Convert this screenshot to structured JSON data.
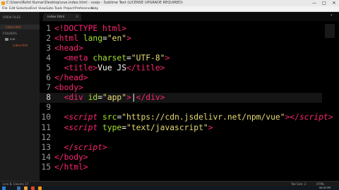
{
  "window": {
    "title": "C:\\Users\\Rohit Kumar\\Desktop\\vue.index.html - vuejs - Sublime Text (LICENSE UPGRADE REQUIRED)",
    "minimize": "—",
    "maximize": "□",
    "close": "✕"
  },
  "menu": [
    "File",
    "Edit",
    "Selection",
    "Find",
    "View",
    "Goto",
    "Tools",
    "Project",
    "Preferences",
    "Help"
  ],
  "sidebar": {
    "open_files_header": "OPEN FILES",
    "open_files": [
      "index.html"
    ],
    "folders_header": "FOLDERS",
    "folder_name": "vue",
    "folder_files": [
      "index.html"
    ]
  },
  "tab": {
    "label": "index.html",
    "close": "×",
    "dropdown": "▾"
  },
  "editor": {
    "lines": [
      {
        "n": "1",
        "parts": [
          {
            "t": "<!DOCTYPE html>",
            "c": "tk-tag"
          }
        ]
      },
      {
        "n": "2",
        "parts": [
          {
            "t": "<html",
            "c": "tk-tag"
          },
          {
            "t": " lang",
            "c": "tk-attr"
          },
          {
            "t": "=",
            "c": "tk-txt"
          },
          {
            "t": "\"en\"",
            "c": "tk-str"
          },
          {
            "t": ">",
            "c": "tk-tag"
          }
        ]
      },
      {
        "n": "3",
        "parts": [
          {
            "t": "<head>",
            "c": "tk-tag"
          }
        ]
      },
      {
        "n": "4",
        "parts": [
          {
            "t": "  <meta",
            "c": "tk-tag"
          },
          {
            "t": " charset",
            "c": "tk-attr"
          },
          {
            "t": "=",
            "c": "tk-txt"
          },
          {
            "t": "\"UTF-8\"",
            "c": "tk-str"
          },
          {
            "t": ">",
            "c": "tk-tag"
          }
        ]
      },
      {
        "n": "5",
        "parts": [
          {
            "t": "  <title>",
            "c": "tk-tag"
          },
          {
            "t": "Vue JS",
            "c": "tk-txt"
          },
          {
            "t": "</title>",
            "c": "tk-tag"
          }
        ]
      },
      {
        "n": "6",
        "parts": [
          {
            "t": "</head>",
            "c": "tk-tag"
          }
        ]
      },
      {
        "n": "7",
        "parts": [
          {
            "t": "<body>",
            "c": "tk-tag"
          }
        ]
      },
      {
        "n": "8",
        "parts": [
          {
            "t": "  <div",
            "c": "tk-tag"
          },
          {
            "t": " id",
            "c": "tk-attr"
          },
          {
            "t": "=",
            "c": "tk-txt"
          },
          {
            "t": "\"app\"",
            "c": "tk-str"
          },
          {
            "t": ">",
            "c": "tk-tag"
          },
          {
            "t": "|",
            "c": "tk-txt"
          },
          {
            "t": "</div>",
            "c": "tk-tag"
          }
        ],
        "highlight": true
      },
      {
        "n": "9",
        "parts": []
      },
      {
        "n": "10",
        "parts": [
          {
            "t": "  <",
            "c": "tk-tag"
          },
          {
            "t": "script",
            "c": "tk-scr"
          },
          {
            "t": " src",
            "c": "tk-attr"
          },
          {
            "t": "=",
            "c": "tk-txt"
          },
          {
            "t": "\"https://cdn.jsdelivr.net/npm/vue\"",
            "c": "tk-str"
          },
          {
            "t": "></",
            "c": "tk-tag"
          },
          {
            "t": "script",
            "c": "tk-scr"
          },
          {
            "t": ">",
            "c": "tk-tag"
          }
        ]
      },
      {
        "n": "11",
        "parts": [
          {
            "t": "  <",
            "c": "tk-tag"
          },
          {
            "t": "script",
            "c": "tk-scr"
          },
          {
            "t": " type",
            "c": "tk-attr"
          },
          {
            "t": "=",
            "c": "tk-txt"
          },
          {
            "t": "\"text/javascript\"",
            "c": "tk-str"
          },
          {
            "t": ">",
            "c": "tk-tag"
          }
        ]
      },
      {
        "n": "12",
        "parts": []
      },
      {
        "n": "13",
        "parts": [
          {
            "t": "  </",
            "c": "tk-tag"
          },
          {
            "t": "script",
            "c": "tk-scr"
          },
          {
            "t": ">",
            "c": "tk-tag"
          }
        ]
      },
      {
        "n": "14",
        "parts": [
          {
            "t": "</body>",
            "c": "tk-tag"
          }
        ]
      },
      {
        "n": "15",
        "parts": [
          {
            "t": "</html>",
            "c": "tk-tag"
          }
        ]
      }
    ]
  },
  "status": {
    "position": "Line 8, Column 17",
    "tab_size": "Tab Size: 2",
    "syntax": "HTML"
  },
  "taskbar": {
    "clock": "08:43 PM"
  },
  "colors": {
    "tag": "#f92672",
    "attr": "#a6e22e",
    "string": "#e6db74",
    "text": "#f8f8f2",
    "background": "#000000"
  }
}
